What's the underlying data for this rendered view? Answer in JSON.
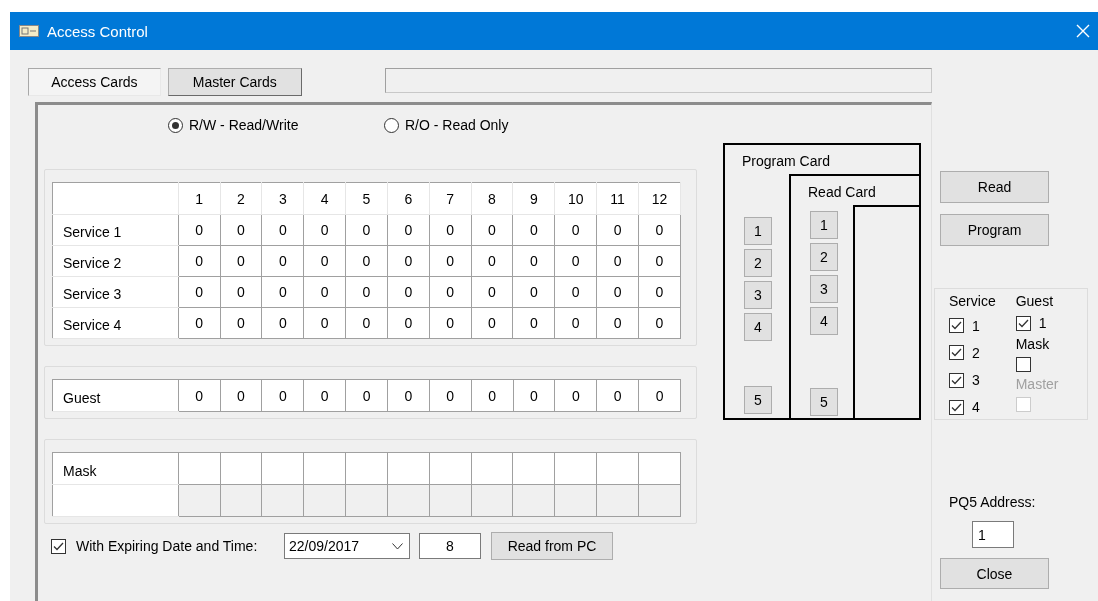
{
  "window": {
    "title": "Access Control"
  },
  "tabs": [
    {
      "label": "Access Cards",
      "selected": true
    },
    {
      "label": "Master Cards",
      "selected": false
    }
  ],
  "mode_options": [
    {
      "label": "R/W - Read/Write",
      "selected": true
    },
    {
      "label": "R/O - Read Only",
      "selected": false
    }
  ],
  "service_table": {
    "columns": [
      "1",
      "2",
      "3",
      "4",
      "5",
      "6",
      "7",
      "8",
      "9",
      "10",
      "11",
      "12"
    ],
    "rows": [
      {
        "label": "Service 1",
        "cells": [
          "0",
          "0",
          "0",
          "0",
          "0",
          "0",
          "0",
          "0",
          "0",
          "0",
          "0",
          "0"
        ]
      },
      {
        "label": "Service 2",
        "cells": [
          "0",
          "0",
          "0",
          "0",
          "0",
          "0",
          "0",
          "0",
          "0",
          "0",
          "0",
          "0"
        ]
      },
      {
        "label": "Service 3",
        "cells": [
          "0",
          "0",
          "0",
          "0",
          "0",
          "0",
          "0",
          "0",
          "0",
          "0",
          "0",
          "0"
        ]
      },
      {
        "label": "Service 4",
        "cells": [
          "0",
          "0",
          "0",
          "0",
          "0",
          "0",
          "0",
          "0",
          "0",
          "0",
          "0",
          "0"
        ]
      }
    ]
  },
  "guest_table": {
    "label": "Guest",
    "cells": [
      "0",
      "0",
      "0",
      "0",
      "0",
      "0",
      "0",
      "0",
      "0",
      "0",
      "0",
      "0"
    ]
  },
  "mask_table": {
    "label": "Mask"
  },
  "expiry": {
    "label": "With Expiring Date and Time:",
    "checked": true,
    "date": "22/09/2017",
    "hour": "8",
    "button": "Read from PC"
  },
  "card_diagram": {
    "program_label": "Program Card",
    "read_label": "Read Card",
    "program_buttons": [
      "1",
      "2",
      "3",
      "4",
      "5"
    ],
    "read_buttons": [
      "1",
      "2",
      "3",
      "4",
      "5"
    ]
  },
  "actions": [
    "Read",
    "Program"
  ],
  "options": {
    "service_title": "Service",
    "service": [
      {
        "label": "1",
        "checked": true
      },
      {
        "label": "2",
        "checked": true
      },
      {
        "label": "3",
        "checked": true
      },
      {
        "label": "4",
        "checked": true
      }
    ],
    "guest_title": "Guest",
    "guest": {
      "label": "1",
      "checked": true
    },
    "mask_title": "Mask",
    "mask": {
      "checked": false
    },
    "master_title": "Master",
    "master": {
      "checked": false,
      "disabled": true
    }
  },
  "address": {
    "label": "PQ5 Address:",
    "value": "1"
  },
  "close_button": "Close"
}
